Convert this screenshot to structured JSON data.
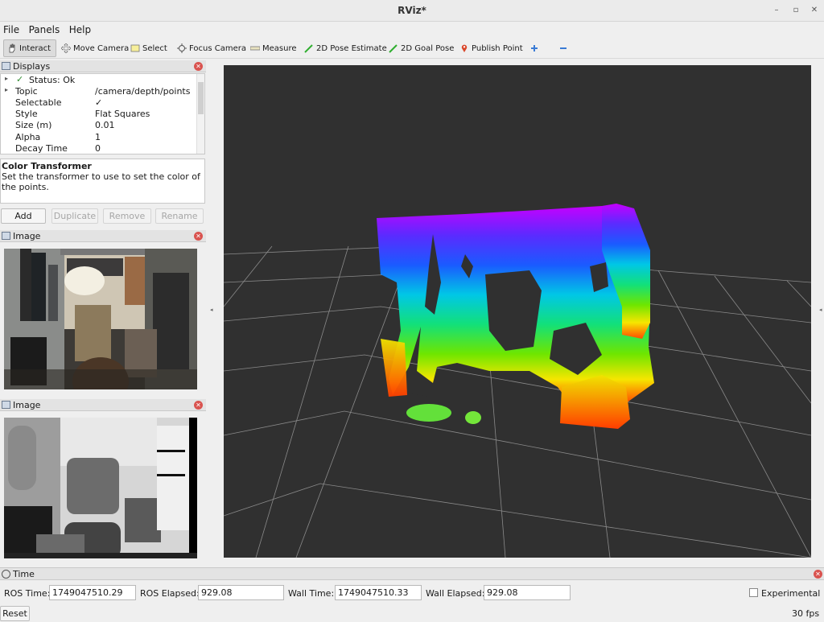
{
  "window": {
    "title": "RViz*"
  },
  "menu": [
    {
      "label": "File"
    },
    {
      "label": "Panels"
    },
    {
      "label": "Help"
    }
  ],
  "toolbar": {
    "interact": "Interact",
    "move_camera": "Move Camera",
    "select": "Select",
    "focus_camera": "Focus Camera",
    "measure": "Measure",
    "pose_estimate": "2D Pose Estimate",
    "goal_pose": "2D Goal Pose",
    "publish_point": "Publish Point"
  },
  "displays": {
    "title": "Displays",
    "rows": [
      {
        "key": "Status: Ok",
        "value": ""
      },
      {
        "key": "Topic",
        "value": "/camera/depth/points"
      },
      {
        "key": "Selectable",
        "value": "✓"
      },
      {
        "key": "Style",
        "value": "Flat Squares"
      },
      {
        "key": "Size (m)",
        "value": "0.01"
      },
      {
        "key": "Alpha",
        "value": "1"
      },
      {
        "key": "Decay Time",
        "value": "0"
      }
    ],
    "description_title": "Color Transformer",
    "description_text": "Set the transformer to use to set the color of the points.",
    "buttons": {
      "add": "Add",
      "duplicate": "Duplicate",
      "remove": "Remove",
      "rename": "Rename"
    }
  },
  "image_panel_1": {
    "title": "Image"
  },
  "image_panel_2": {
    "title": "Image"
  },
  "time": {
    "title": "Time",
    "ros_time_label": "ROS Time:",
    "ros_time": "1749047510.29",
    "ros_elapsed_label": "ROS Elapsed:",
    "ros_elapsed": "929.08",
    "wall_time_label": "Wall Time:",
    "wall_time": "1749047510.33",
    "wall_elapsed_label": "Wall Elapsed:",
    "wall_elapsed": "929.08",
    "experimental_label": "Experimental",
    "reset": "Reset",
    "fps": "30 fps"
  }
}
